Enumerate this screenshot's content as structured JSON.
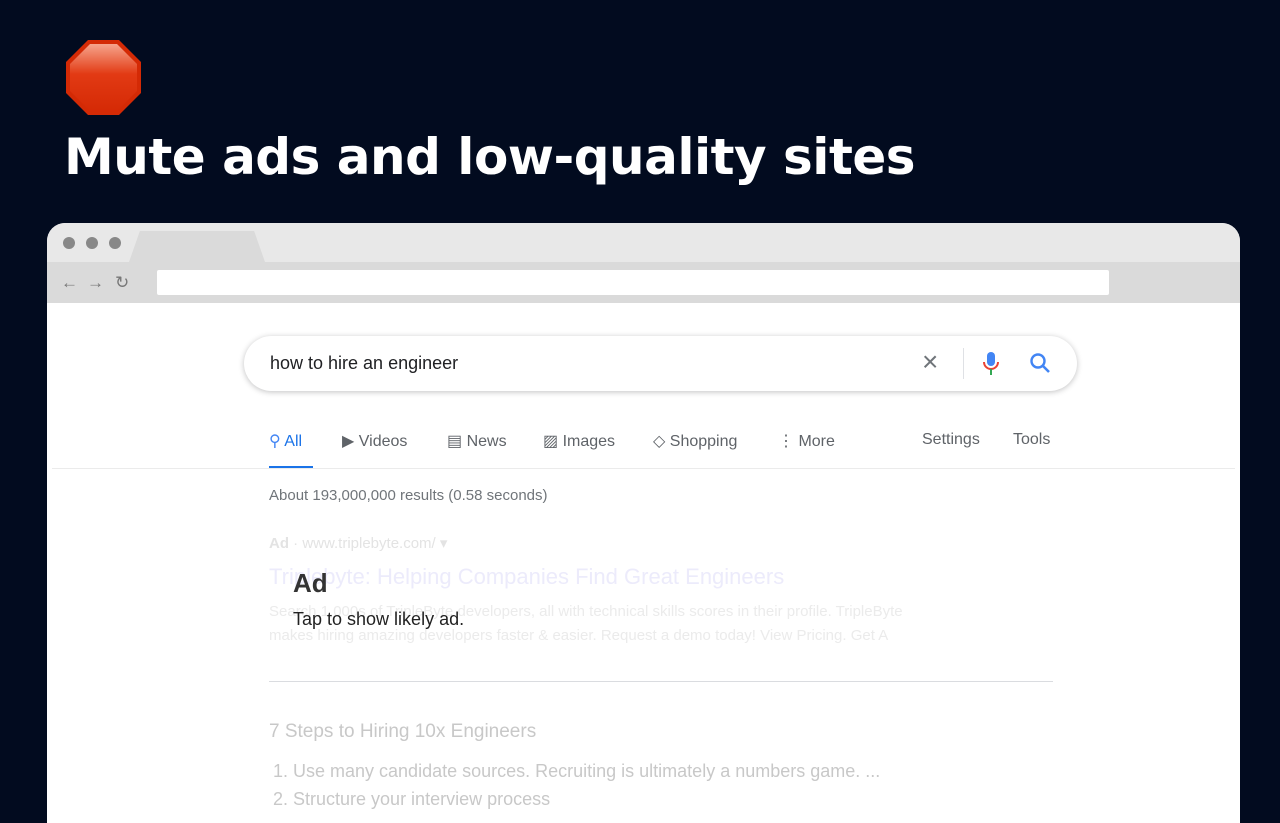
{
  "headline": "Mute ads and low-quality sites",
  "search": {
    "query": "how to hire an engineer"
  },
  "tabs": {
    "all": "All",
    "videos": "Videos",
    "news": "News",
    "images": "Images",
    "shopping": "Shopping",
    "more": "More",
    "settings": "Settings",
    "tools": "Tools"
  },
  "stats": "About 193,000,000 results (0.58 seconds)",
  "ad": {
    "label": "Ad",
    "url": "· www.triplebyte.com/ ▾",
    "title": "Triplebyte: Helping Companies Find Great Engineers",
    "desc1": "Search 1,000s of TripleByte developers, all with technical skills scores in their profile. TripleByte",
    "desc2": "makes hiring amazing developers faster & easier. Request a demo today! View Pricing. Get A"
  },
  "overlay": {
    "title": "Ad",
    "subtitle": "Tap to show likely ad."
  },
  "result2": {
    "title": "7 Steps to Hiring 10x Engineers",
    "items": [
      "1. Use many candidate sources. Recruiting is ultimately a numbers game. ...",
      "2. Structure your interview process"
    ]
  },
  "colors": {
    "background": "#020b1f",
    "accent": "#1a73e8",
    "stop": "#d92b0a"
  }
}
